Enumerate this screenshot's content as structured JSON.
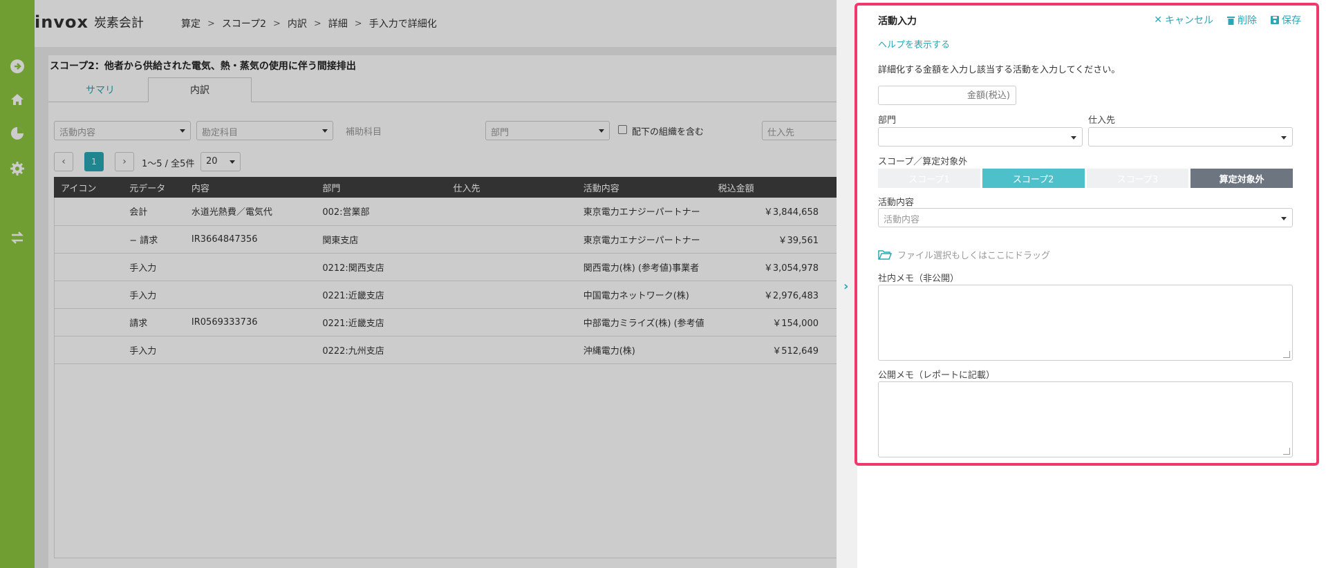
{
  "app": {
    "brand_word": "invox",
    "brand_sub": "炭素会計",
    "accent_color": "#2aa7b5",
    "sidebar_color": "#8cc63f"
  },
  "breadcrumb": [
    "算定",
    "スコープ2",
    "内訳",
    "詳細",
    "手入力で詳細化"
  ],
  "sidebar": [
    "arrow-right-circle-icon",
    "home-icon",
    "pie-chart-icon",
    "gear-icon",
    "transfer-icon"
  ],
  "page": {
    "title": "スコープ2：他者から供給された電気、熱・蒸気の使用に伴う間接排出",
    "tabs": [
      "サマリ",
      "内訳"
    ]
  },
  "filters": {
    "activity": "活動内容",
    "account": "勘定科目",
    "sub_account": "補助科目",
    "department": "部門",
    "include_sub": "配下の組織を含む",
    "supplier": "仕入先"
  },
  "pager": {
    "current": "1",
    "range": "1〜5 / 全5件",
    "page_size": "20"
  },
  "table": {
    "columns": [
      "アイコン",
      "元データ",
      "内容",
      "部門",
      "仕入先",
      "活動内容",
      "税込金額"
    ],
    "rows": [
      {
        "icon": "",
        "source": "会計",
        "content": "水道光熱費／電気代",
        "dept": "002:営業部",
        "supplier": "",
        "activity": "東京電力エナジーパートナー",
        "amount": "￥3,844,658"
      },
      {
        "icon": "",
        "source": "− 請求",
        "content": "IR3664847356",
        "dept": "関東支店",
        "supplier": "",
        "activity": "東京電力エナジーパートナー",
        "amount": "￥39,561"
      },
      {
        "icon": "",
        "source": "手入力",
        "content": "",
        "dept": "0212:関西支店",
        "supplier": "",
        "activity": "関西電力(株) (参考値)事業者",
        "amount": "￥3,054,978"
      },
      {
        "icon": "",
        "source": "手入力",
        "content": "",
        "dept": "0221:近畿支店",
        "supplier": "",
        "activity": "中国電力ネットワーク(株)",
        "amount": "￥2,976,483"
      },
      {
        "icon": "",
        "source": "請求",
        "content": "IR0569333736",
        "dept": "0221:近畿支店",
        "supplier": "",
        "activity": "中部電力ミライズ(株) (参考値",
        "amount": "￥154,000"
      },
      {
        "icon": "",
        "source": "手入力",
        "content": "",
        "dept": "0222:九州支店",
        "supplier": "",
        "activity": "沖縄電力(株)",
        "amount": "￥512,649"
      }
    ]
  },
  "panel": {
    "title": "活動入力",
    "cancel": "キャンセル",
    "delete": "削除",
    "save": "保存",
    "help": "ヘルプを表示する",
    "description": "詳細化する金額を入力し該当する活動を入力してください。",
    "amount_placeholder": "金額(税込)",
    "dept_label": "部門",
    "supplier_label": "仕入先",
    "scope_label": "スコープ／算定対象外",
    "scope_options": [
      "スコープ1",
      "スコープ2",
      "スコープ3",
      "算定対象外"
    ],
    "scope_selected": "スコープ2",
    "activity_label": "活動内容",
    "activity_placeholder": "活動内容",
    "file_text": "ファイル選択もしくはここにドラッグ",
    "internal_memo_label": "社内メモ（非公開）",
    "public_memo_label": "公開メモ（レポートに記載）",
    "highlight_color": "#f0386b"
  }
}
